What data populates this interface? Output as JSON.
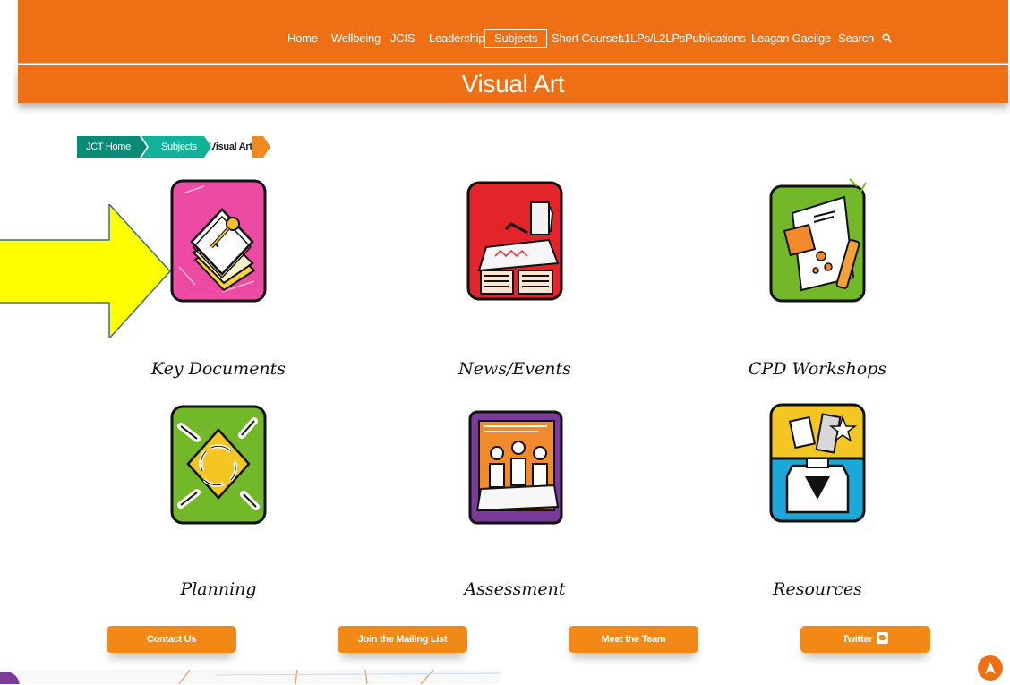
{
  "nav": {
    "items": [
      "Home",
      "Wellbeing",
      "JCIS",
      "Leadership",
      "Subjects",
      "Short Courses",
      "L1LPs/L2LPs",
      "Publications",
      "Leagan Gaeilge",
      "Search"
    ],
    "active": "Subjects",
    "search_icon": "search-icon"
  },
  "page": {
    "title": "Visual Art"
  },
  "breadcrumb": {
    "items": [
      "JCT Home",
      "Subjects",
      "Visual Art"
    ]
  },
  "tiles": [
    {
      "label": "Key Documents",
      "color": "#ec4aa3",
      "icon": "key-documents-icon"
    },
    {
      "label": "News/Events",
      "color": "#e3242b",
      "icon": "news-events-icon"
    },
    {
      "label": "CPD Workshops",
      "color": "#72b829",
      "icon": "cpd-workshops-icon"
    },
    {
      "label": "Planning",
      "color": "#72b829",
      "icon": "planning-icon"
    },
    {
      "label": "Assessment",
      "color": "#7b3a9c",
      "icon": "assessment-icon"
    },
    {
      "label": "Resources",
      "color": "#1ba7d8",
      "icon": "resources-icon"
    }
  ],
  "footer": {
    "contact": "Contact Us",
    "mailing": "Join the Mailing List",
    "team": "Meet the Team",
    "twitter": "Twitter"
  },
  "colors": {
    "brand_orange": "#ee6f14",
    "button_orange": "#f28916",
    "teal_dark": "#0a8b77",
    "teal_light": "#12b29a",
    "arrow_yellow": "#ffff00"
  }
}
